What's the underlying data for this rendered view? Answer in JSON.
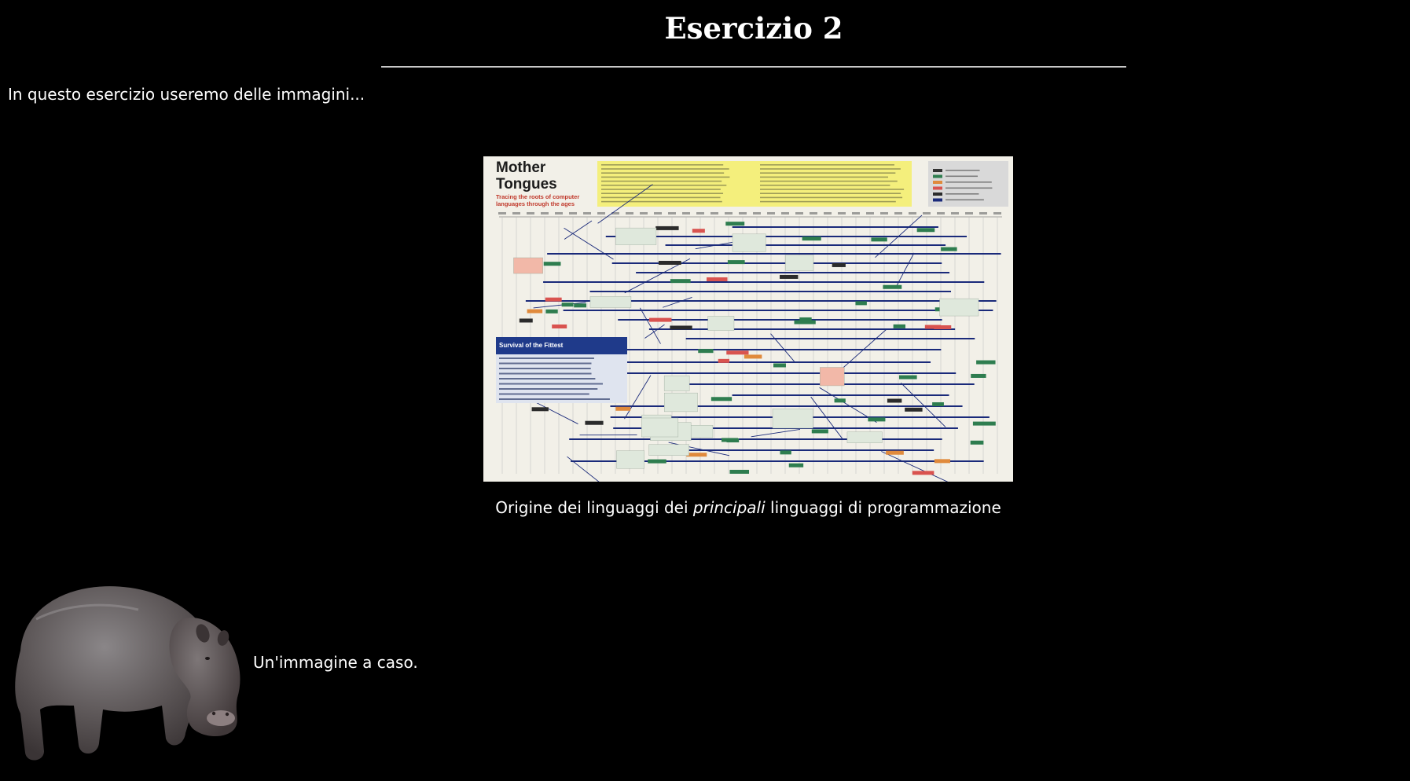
{
  "page": {
    "title": "Esercizio 2",
    "intro": "In questo esercizio useremo delle immagini..."
  },
  "figure": {
    "poster_title_line1": "Mother",
    "poster_title_line2": "Tongues",
    "poster_subtitle_line1": "Tracing the roots of computer",
    "poster_subtitle_line2": "languages through the ages",
    "survival_title": "Survival of the Fittest",
    "caption_before": "Origine dei linguaggi dei ",
    "caption_emphasis": "principali",
    "caption_after": " linguaggi di programmazione"
  },
  "hippo": {
    "caption": "Un'immagine a caso."
  },
  "colors": {
    "background": "#000000",
    "text": "#ffffff",
    "rule": "#c8c8c8",
    "poster_bg": "#f2f0e8",
    "poster_title": "#1b1b1b",
    "poster_subtitle": "#c0392b",
    "poster_intro_bg": "#f4ef7c",
    "timeline_line": "#1a2a7a",
    "box_green": "#2e7d4f",
    "box_dark": "#2b2b2b",
    "box_red": "#d9534f",
    "box_note": "#dfe8dc",
    "survival_bg": "#1f3a8a"
  }
}
